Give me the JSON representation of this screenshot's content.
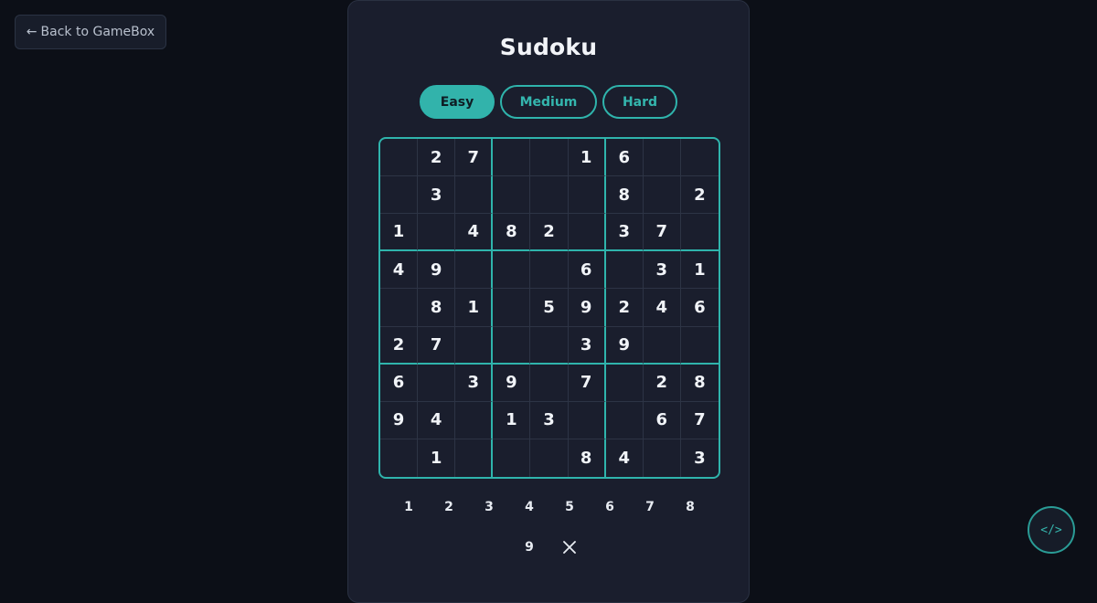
{
  "back_button": {
    "arrow": "←",
    "label": "Back to GameBox"
  },
  "title": "Sudoku",
  "difficulty": {
    "options": [
      "Easy",
      "Medium",
      "Hard"
    ],
    "selected": "Easy"
  },
  "board": [
    [
      "",
      "2",
      "7",
      "",
      "",
      "1",
      "6",
      "",
      ""
    ],
    [
      "",
      "3",
      "",
      "",
      "",
      "",
      "8",
      "",
      "2"
    ],
    [
      "1",
      "",
      "4",
      "8",
      "2",
      "",
      "3",
      "7",
      ""
    ],
    [
      "4",
      "9",
      "",
      "",
      "",
      "6",
      "",
      "3",
      "1"
    ],
    [
      "",
      "8",
      "1",
      "",
      "5",
      "9",
      "2",
      "4",
      "6"
    ],
    [
      "2",
      "7",
      "",
      "",
      "",
      "3",
      "9",
      "",
      ""
    ],
    [
      "6",
      "",
      "3",
      "9",
      "",
      "7",
      "",
      "2",
      "8"
    ],
    [
      "9",
      "4",
      "",
      "1",
      "3",
      "",
      "",
      "6",
      "7"
    ],
    [
      "",
      "1",
      "",
      "",
      "",
      "8",
      "4",
      "",
      "3"
    ]
  ],
  "numpad": [
    "1",
    "2",
    "3",
    "4",
    "5",
    "6",
    "7",
    "8",
    "9"
  ],
  "erase_icon": "close-icon",
  "code_button": {
    "label": "</>",
    "icon": "code-icon"
  },
  "colors": {
    "accent": "#2fb4ac",
    "background": "#0c0f17",
    "panel": "#1a1e2d",
    "text": "#f1f4f8"
  }
}
